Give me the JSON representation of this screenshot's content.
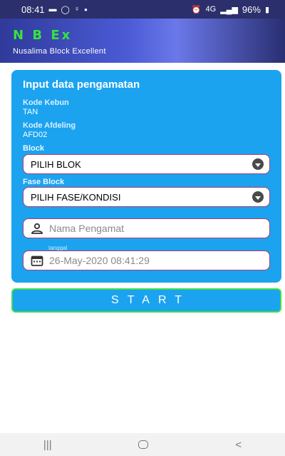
{
  "status_bar": {
    "time": "08:41",
    "notif_icons": [
      "message-icon",
      "whatsapp-icon",
      "location-icon"
    ],
    "dot": "•",
    "signal_text": "4G",
    "battery_percent": "96%"
  },
  "header": {
    "logo": "N B Ex",
    "subtitle": "Nusalima Block Excellent"
  },
  "form": {
    "title": "Input data pengamatan",
    "kode_kebun_label": "Kode Kebun",
    "kode_kebun_value": "TAN",
    "kode_afdeling_label": "Kode Afdeling",
    "kode_afdeling_value": "AFD02",
    "block_label": "Block",
    "block_selected": "PILIH BLOK",
    "fase_label": "Fase Block",
    "fase_selected": "PILIH FASE/KONDISI",
    "nama_placeholder": "Nama Pengamat",
    "tanggal_label": "tanggal",
    "tanggal_value": "26-May-2020 08:41:29"
  },
  "start_button": "START",
  "nav": {
    "recent": "|||",
    "back": "<"
  },
  "colors": {
    "card": "#1ba3f0",
    "accent_border": "#b23a70",
    "start_border": "#3fe04a",
    "logo": "#34e53a"
  }
}
